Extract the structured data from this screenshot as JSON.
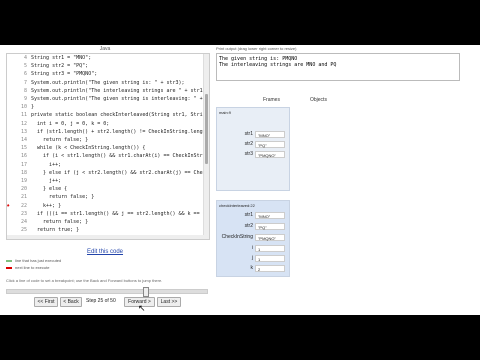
{
  "code_panel": {
    "title": "Java",
    "lines": [
      {
        "no": "4",
        "text": "String str1 = \"MNO\";"
      },
      {
        "no": "5",
        "text": "String str2 = \"PQ\";"
      },
      {
        "no": "6",
        "text": "String str3 = \"PMQNO\";"
      },
      {
        "no": "7",
        "text": "System.out.println(\"The given string is: \" + str3);"
      },
      {
        "no": "8",
        "text": "System.out.println(\"The interleaving strings are \" + str1 +"
      },
      {
        "no": "9",
        "text": "System.out.println(\"The given string is interleaving: \" + che"
      },
      {
        "no": "10",
        "text": "}"
      },
      {
        "no": "11",
        "text": "private static boolean checkInterleaved(String str1, String str"
      },
      {
        "no": "12",
        "text": "  int i = 0, j = 0, k = 0;"
      },
      {
        "no": "13",
        "text": "  if (str1.length() + str2.length() != CheckInString.length"
      },
      {
        "no": "14",
        "text": "    return false; }"
      },
      {
        "no": "15",
        "text": "  while (k < CheckInString.length()) {"
      },
      {
        "no": "16",
        "text": "    if (i < str1.length() && str1.charAt(i) == CheckInString"
      },
      {
        "no": "17",
        "text": "      i++;"
      },
      {
        "no": "18",
        "text": "    } else if (j < str2.length() && str2.charAt(j) == CheckInS"
      },
      {
        "no": "19",
        "text": "      j++;"
      },
      {
        "no": "20",
        "text": "    } else {"
      },
      {
        "no": "21",
        "text": "      return false; }"
      },
      {
        "no": "22",
        "text": "    k++; }"
      },
      {
        "no": "23",
        "text": "  if (((i == str1.length() && j == str2.length() && k == Ch"
      },
      {
        "no": "24",
        "text": "    return false; }"
      },
      {
        "no": "25",
        "text": "  return true; }"
      }
    ],
    "edit_link": "Edit this code",
    "legend_executed": "line that has just executed",
    "legend_next": "next line to execute",
    "hint": "Click a line of code to set a breakpoint; use the Back and Forward buttons to jump there.",
    "colors": {
      "next_arrow": "#dd0000",
      "executed_arrow": "#7fbf7f"
    }
  },
  "navigation": {
    "first": "<< First",
    "back": "< Back",
    "step": "Step 25 of 50",
    "forward": "Forward >",
    "last": "Last >>",
    "progress": 0.5
  },
  "output": {
    "label": "Print output (drag lower right corner to resize)",
    "lines": [
      "The given string is: PMQNO",
      "The interleaving strings are MNO and PQ"
    ]
  },
  "viz": {
    "frames_header": "Frames",
    "objects_header": "Objects"
  },
  "frames": [
    {
      "name": "main:9",
      "vars": [
        {
          "name": "str1",
          "value": "\"MNO\""
        },
        {
          "name": "str2",
          "value": "\"PQ\""
        },
        {
          "name": "str3",
          "value": "\"PMQNO\""
        }
      ]
    },
    {
      "name": "checkInterleaved:22",
      "vars": [
        {
          "name": "str1",
          "value": "\"MNO\""
        },
        {
          "name": "str2",
          "value": "\"PQ\""
        },
        {
          "name": "CheckInString",
          "value": "\"PMQNO\""
        },
        {
          "name": "i",
          "value": "1"
        },
        {
          "name": "j",
          "value": "1"
        },
        {
          "name": "k",
          "value": "2"
        }
      ]
    }
  ]
}
